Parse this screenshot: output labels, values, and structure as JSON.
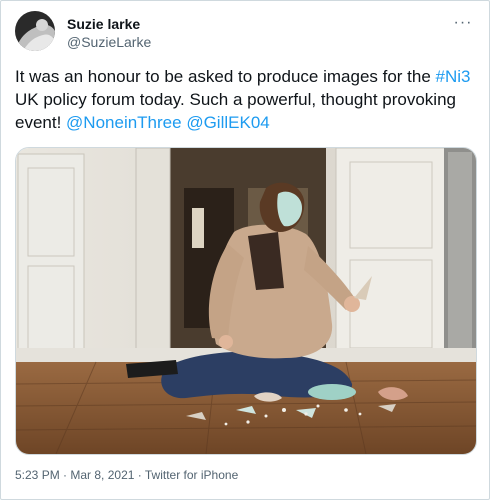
{
  "tweet": {
    "display_name": "Suzie larke",
    "handle": "@SuzieLarke",
    "text_before": "It was an honour to be asked to produce images for the ",
    "hashtag": "#Ni3",
    "text_middle": " UK policy forum today. Such a powerful, thought provoking event! ",
    "mention1": "@NoneinThree",
    "space": " ",
    "mention2": "@GillEK04",
    "time": "5:23 PM",
    "date": "Mar 8, 2021",
    "source": "Twitter for iPhone",
    "more_label": "···",
    "separator": " · "
  },
  "icons": {
    "more": "more-horizontal-icon"
  }
}
